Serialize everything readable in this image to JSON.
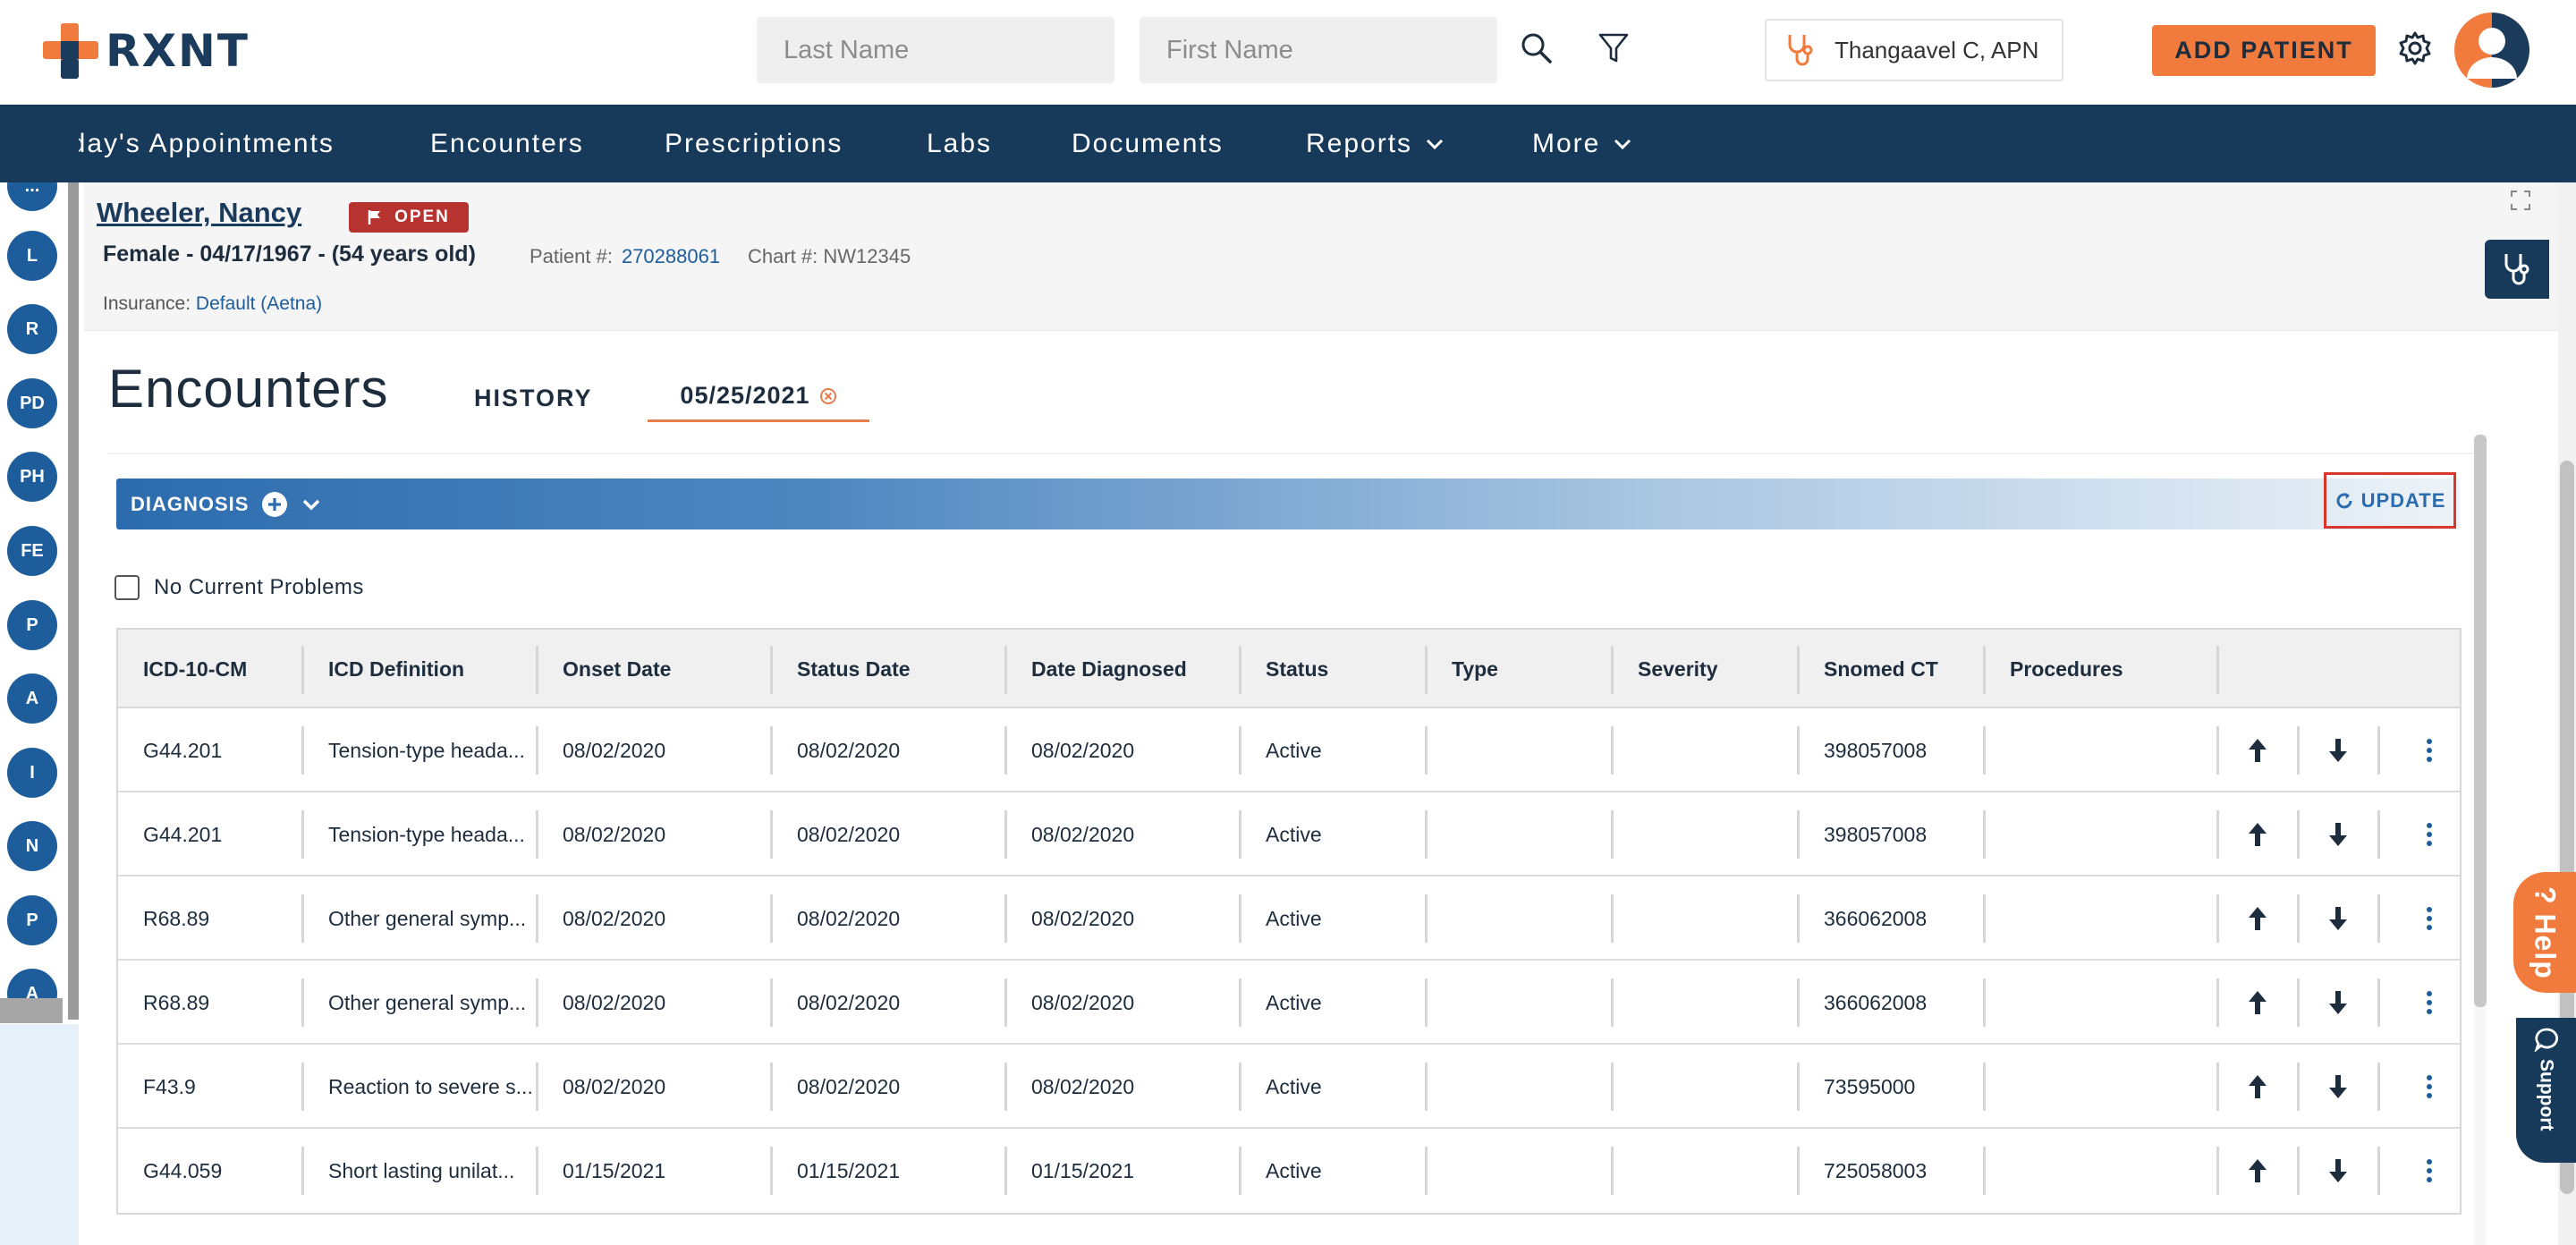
{
  "header": {
    "logo_text": "RXNT",
    "last_name_placeholder": "Last Name",
    "first_name_placeholder": "First Name",
    "provider_name": "Thangaavel C, APN",
    "add_patient_label": "ADD PATIENT"
  },
  "nav": {
    "items": [
      {
        "label": "Today's Appointments"
      },
      {
        "label": "Encounters"
      },
      {
        "label": "Prescriptions"
      },
      {
        "label": "Labs"
      },
      {
        "label": "Documents"
      },
      {
        "label": "Reports"
      },
      {
        "label": "More"
      }
    ]
  },
  "rail": {
    "items": [
      "...",
      "L",
      "R",
      "PD",
      "PH",
      "FE",
      "P",
      "A",
      "I",
      "N",
      "P",
      "A"
    ]
  },
  "patient": {
    "name": "Wheeler, Nancy",
    "status_badge": "OPEN",
    "demographics": "Female - 04/17/1967 - (54 years old)",
    "patient_no_label": "Patient #:",
    "patient_no": "270288061",
    "chart_no_label": "Chart #:",
    "chart_no": "NW12345",
    "insurance_label": "Insurance:",
    "insurance_value": "Default (Aetna)"
  },
  "main": {
    "title": "Encounters",
    "tab_history": "HISTORY",
    "tab_date": "05/25/2021",
    "section_title": "DIAGNOSIS",
    "update_label": "UPDATE",
    "no_problems_label": "No Current Problems"
  },
  "table": {
    "columns": [
      "ICD-10-CM",
      "ICD Definition",
      "Onset Date",
      "Status Date",
      "Date Diagnosed",
      "Status",
      "Type",
      "Severity",
      "Snomed CT",
      "Procedures"
    ],
    "rows": [
      {
        "icd": "G44.201",
        "definition": "Tension-type heada...",
        "onset": "08/02/2020",
        "status_date": "08/02/2020",
        "diagnosed": "08/02/2020",
        "status": "Active",
        "type": "",
        "severity": "",
        "snomed": "398057008",
        "procedures": ""
      },
      {
        "icd": "G44.201",
        "definition": "Tension-type heada...",
        "onset": "08/02/2020",
        "status_date": "08/02/2020",
        "diagnosed": "08/02/2020",
        "status": "Active",
        "type": "",
        "severity": "",
        "snomed": "398057008",
        "procedures": ""
      },
      {
        "icd": "R68.89",
        "definition": "Other general symp...",
        "onset": "08/02/2020",
        "status_date": "08/02/2020",
        "diagnosed": "08/02/2020",
        "status": "Active",
        "type": "",
        "severity": "",
        "snomed": "366062008",
        "procedures": ""
      },
      {
        "icd": "R68.89",
        "definition": "Other general symp...",
        "onset": "08/02/2020",
        "status_date": "08/02/2020",
        "diagnosed": "08/02/2020",
        "status": "Active",
        "type": "",
        "severity": "",
        "snomed": "366062008",
        "procedures": ""
      },
      {
        "icd": "F43.9",
        "definition": "Reaction to severe s...",
        "onset": "08/02/2020",
        "status_date": "08/02/2020",
        "diagnosed": "08/02/2020",
        "status": "Active",
        "type": "",
        "severity": "",
        "snomed": "73595000",
        "procedures": ""
      },
      {
        "icd": "G44.059",
        "definition": "Short lasting unilat...",
        "onset": "01/15/2021",
        "status_date": "01/15/2021",
        "diagnosed": "01/15/2021",
        "status": "Active",
        "type": "",
        "severity": "",
        "snomed": "725058003",
        "procedures": ""
      }
    ]
  },
  "widgets": {
    "help_label": "Help",
    "support_label": "Support"
  },
  "colors": {
    "brand_navy": "#173a5b",
    "brand_orange": "#f07b3c",
    "link_blue": "#1d5d9b",
    "badge_red": "#b6332f"
  }
}
